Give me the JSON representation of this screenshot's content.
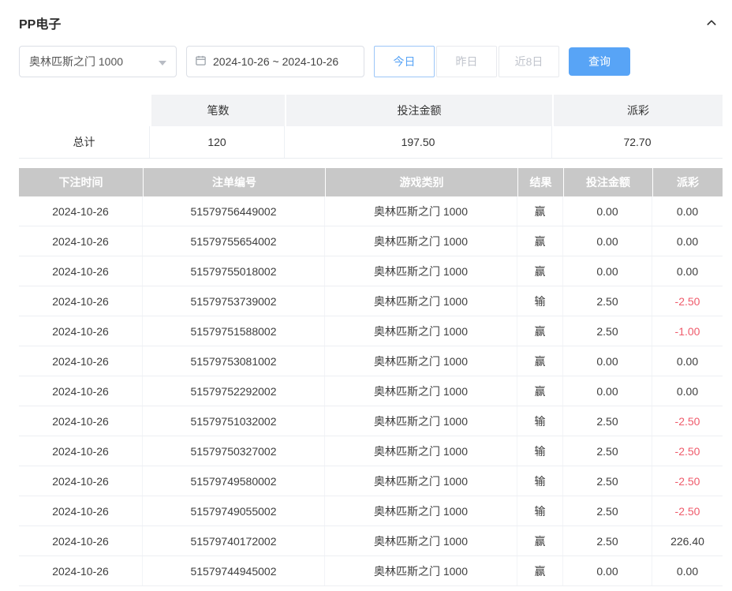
{
  "header": {
    "title": "PP电子"
  },
  "filters": {
    "game_select": {
      "value": "奥林匹斯之门 1000"
    },
    "date_range": {
      "value": "2024-10-26 ~ 2024-10-26"
    },
    "quick_buttons": [
      {
        "label": "今日",
        "active": true
      },
      {
        "label": "昨日",
        "active": false
      },
      {
        "label": "近8日",
        "active": false
      }
    ],
    "search_button": "查询"
  },
  "summary": {
    "headers": [
      "",
      "笔数",
      "投注金额",
      "派彩"
    ],
    "row": {
      "label": "总计",
      "count": "120",
      "bet_amount": "197.50",
      "payout": "72.70"
    }
  },
  "table": {
    "headers": [
      "下注时间",
      "注单编号",
      "游戏类别",
      "结果",
      "投注金额",
      "派彩"
    ],
    "rows": [
      {
        "date": "2024-10-26",
        "order_id": "51579756449002",
        "game": "奥林匹斯之门 1000",
        "result": "赢",
        "bet": "0.00",
        "payout": "0.00"
      },
      {
        "date": "2024-10-26",
        "order_id": "51579755654002",
        "game": "奥林匹斯之门 1000",
        "result": "赢",
        "bet": "0.00",
        "payout": "0.00"
      },
      {
        "date": "2024-10-26",
        "order_id": "51579755018002",
        "game": "奥林匹斯之门 1000",
        "result": "赢",
        "bet": "0.00",
        "payout": "0.00"
      },
      {
        "date": "2024-10-26",
        "order_id": "51579753739002",
        "game": "奥林匹斯之门 1000",
        "result": "输",
        "bet": "2.50",
        "payout": "-2.50"
      },
      {
        "date": "2024-10-26",
        "order_id": "51579751588002",
        "game": "奥林匹斯之门 1000",
        "result": "赢",
        "bet": "2.50",
        "payout": "-1.00"
      },
      {
        "date": "2024-10-26",
        "order_id": "51579753081002",
        "game": "奥林匹斯之门 1000",
        "result": "赢",
        "bet": "0.00",
        "payout": "0.00"
      },
      {
        "date": "2024-10-26",
        "order_id": "51579752292002",
        "game": "奥林匹斯之门 1000",
        "result": "赢",
        "bet": "0.00",
        "payout": "0.00"
      },
      {
        "date": "2024-10-26",
        "order_id": "51579751032002",
        "game": "奥林匹斯之门 1000",
        "result": "输",
        "bet": "2.50",
        "payout": "-2.50"
      },
      {
        "date": "2024-10-26",
        "order_id": "51579750327002",
        "game": "奥林匹斯之门 1000",
        "result": "输",
        "bet": "2.50",
        "payout": "-2.50"
      },
      {
        "date": "2024-10-26",
        "order_id": "51579749580002",
        "game": "奥林匹斯之门 1000",
        "result": "输",
        "bet": "2.50",
        "payout": "-2.50"
      },
      {
        "date": "2024-10-26",
        "order_id": "51579749055002",
        "game": "奥林匹斯之门 1000",
        "result": "输",
        "bet": "2.50",
        "payout": "-2.50"
      },
      {
        "date": "2024-10-26",
        "order_id": "51579740172002",
        "game": "奥林匹斯之门 1000",
        "result": "赢",
        "bet": "2.50",
        "payout": "226.40"
      },
      {
        "date": "2024-10-26",
        "order_id": "51579744945002",
        "game": "奥林匹斯之门 1000",
        "result": "赢",
        "bet": "0.00",
        "payout": "0.00"
      }
    ]
  },
  "colors": {
    "accent": "#58a4f6",
    "negative": "#ef5b6b",
    "table_header_bg": "#c8c8c8",
    "summary_header_bg": "#f2f3f5"
  }
}
